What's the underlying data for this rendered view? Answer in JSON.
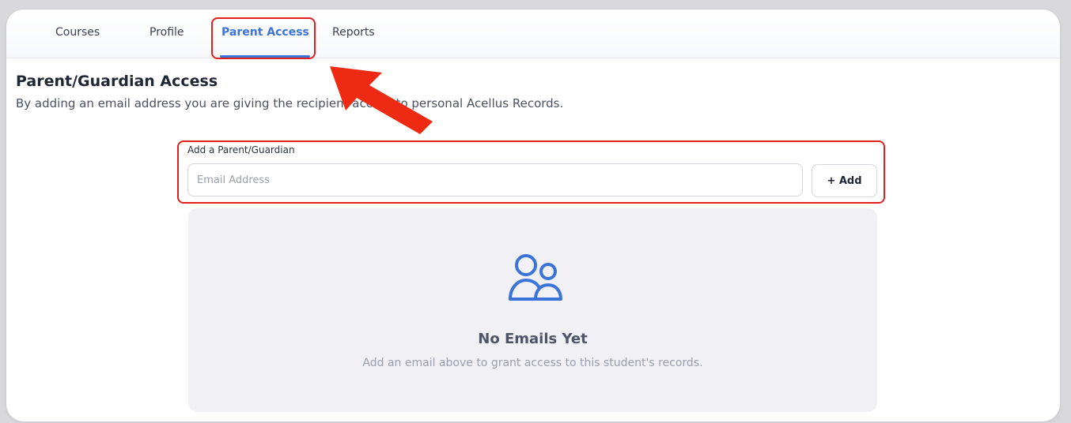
{
  "tabs": [
    {
      "label": "Courses",
      "active": false
    },
    {
      "label": "Profile",
      "active": false
    },
    {
      "label": "Parent Access",
      "active": true
    },
    {
      "label": "Reports",
      "active": false
    }
  ],
  "page": {
    "title": "Parent/Guardian Access",
    "subtitle": "By adding an email address you are giving the recipient access to personal Acellus Records."
  },
  "form": {
    "label": "Add a Parent/Guardian",
    "email_placeholder": "Email Address",
    "email_value": "",
    "add_button": "+ Add"
  },
  "empty_state": {
    "icon": "users-icon",
    "title": "No Emails Yet",
    "message": "Add an email above to grant access to this student's records."
  },
  "colors": {
    "accent": "#3a74d8",
    "highlight": "#e0201b"
  }
}
